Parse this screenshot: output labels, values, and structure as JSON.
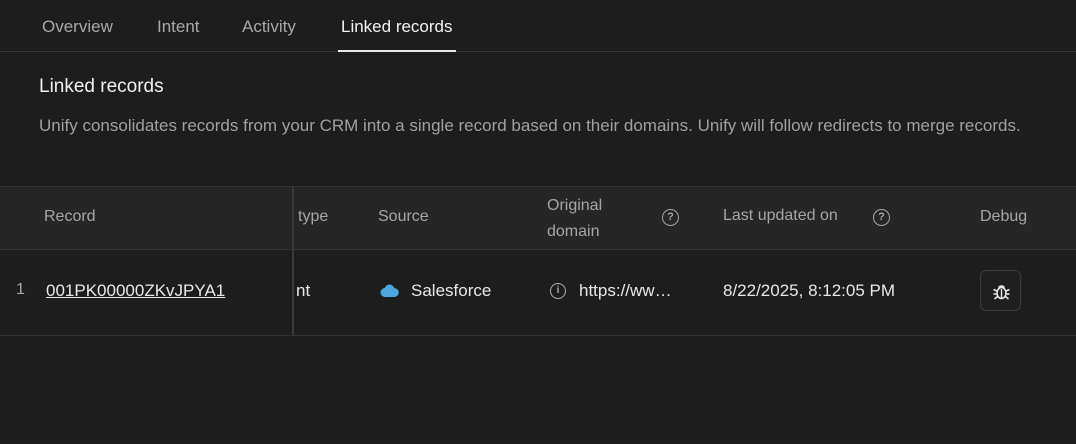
{
  "tabs": [
    {
      "label": "Overview"
    },
    {
      "label": "Intent"
    },
    {
      "label": "Activity"
    },
    {
      "label": "Linked records"
    }
  ],
  "section": {
    "title": "Linked records",
    "description": "Unify consolidates records from your CRM into a single record based on their domains. Unify will follow redirects to merge records."
  },
  "table": {
    "headers": {
      "record": "Record",
      "type": "type",
      "source": "Source",
      "original_domain": "Original domain",
      "last_updated": "Last updated on",
      "debug": "Debug"
    },
    "rows": [
      {
        "index": "1",
        "record": "001PK00000ZKvJPYA1",
        "type": "nt",
        "source": "Salesforce",
        "original_domain": "https://ww…",
        "last_updated": "8/22/2025, 8:12:05 PM"
      }
    ]
  },
  "icons": {
    "help": "help-circle-icon",
    "info": "info-circle-icon",
    "salesforce": "salesforce-cloud-icon",
    "debug": "bug-icon"
  },
  "colors": {
    "background": "#1d1d1d",
    "header_bg": "#262626",
    "salesforce": "#4aa7e0"
  }
}
